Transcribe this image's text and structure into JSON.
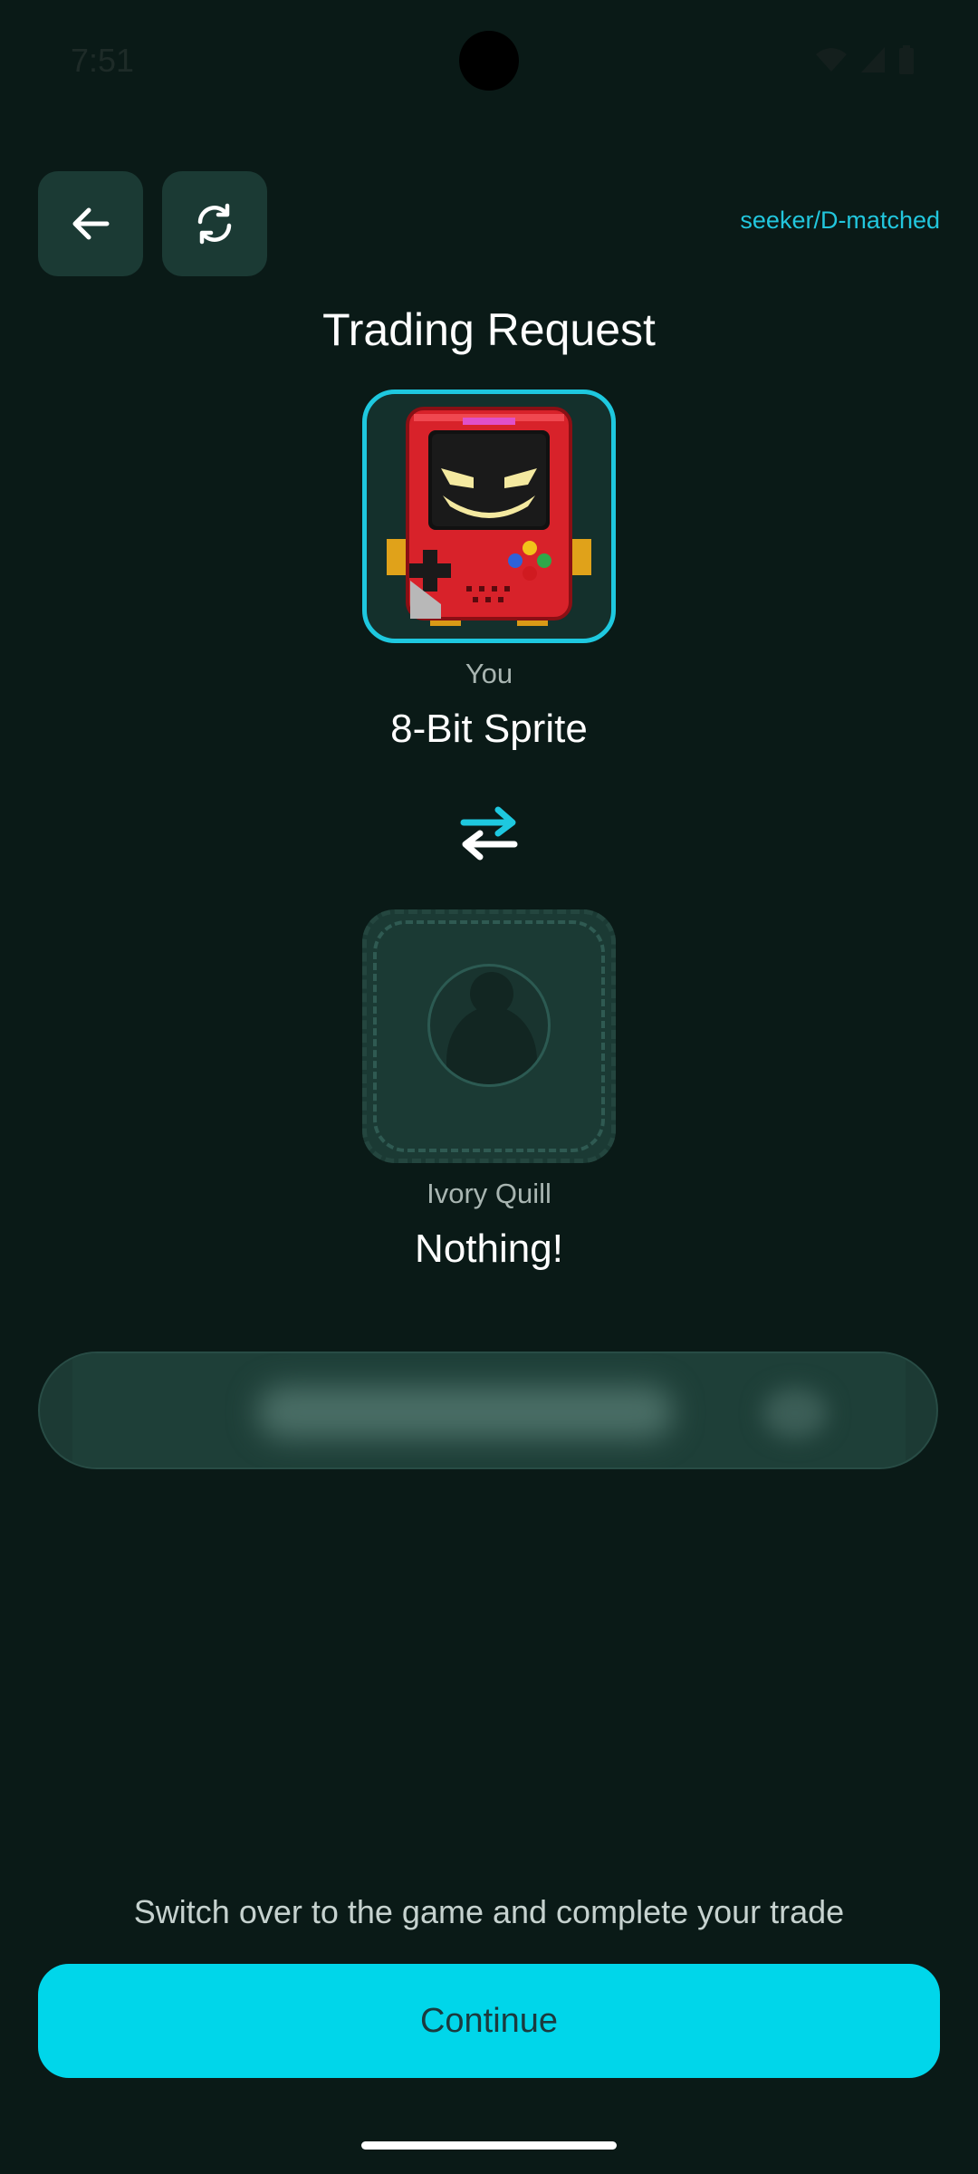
{
  "status_bar": {
    "time": "7:51",
    "icons": [
      "wifi-icon",
      "signal-icon",
      "battery-icon"
    ]
  },
  "header": {
    "back_icon": "arrow-left-icon",
    "refresh_icon": "refresh-icon",
    "user_tag": "seeker/D-matched"
  },
  "page": {
    "title": "Trading Request"
  },
  "trade": {
    "you": {
      "owner": "You",
      "item": "8-Bit Sprite",
      "image_icon": "pixel-handheld-console-icon"
    },
    "swap_icon": "swap-arrows-icon",
    "other": {
      "owner": "Ivory Quill",
      "item": "Nothing!",
      "image_icon": "empty-avatar-placeholder-icon"
    }
  },
  "footer": {
    "hint": "Switch over to the game and complete your trade",
    "continue_label": "Continue"
  },
  "colors": {
    "background": "#0a1a17",
    "accent": "#00d6ea",
    "card": "#1b3a34"
  }
}
